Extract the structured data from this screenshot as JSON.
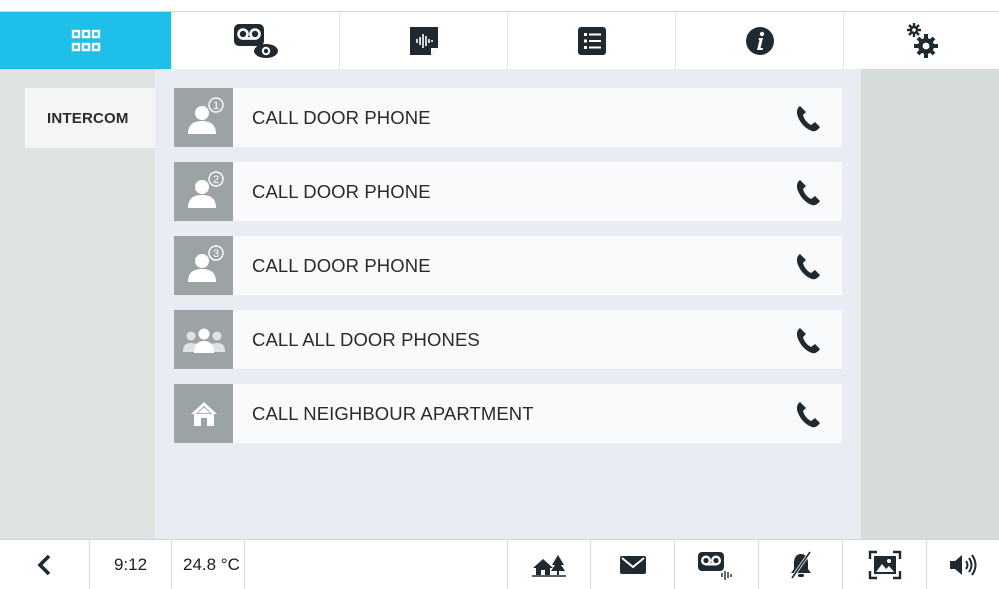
{
  "colors": {
    "accent": "#1ec0ea",
    "icon_dark": "#1f2a30",
    "icon_tile": "#9ba3a5"
  },
  "topnav": {
    "tabs": [
      {
        "name": "home-grid",
        "icon": "grid-icon",
        "active": true
      },
      {
        "name": "video-surveillance",
        "icon": "voicemail-eye-icon",
        "active": false
      },
      {
        "name": "audio-messages",
        "icon": "audio-wave-icon",
        "active": false
      },
      {
        "name": "list",
        "icon": "list-icon",
        "active": false
      },
      {
        "name": "info",
        "icon": "info-icon",
        "active": false
      },
      {
        "name": "settings",
        "icon": "gears-icon",
        "active": false
      }
    ]
  },
  "sidebar": {
    "items": [
      {
        "label": "INTERCOM",
        "selected": true
      }
    ]
  },
  "main": {
    "rows": [
      {
        "label": "CALL DOOR PHONE",
        "icon": "person-icon",
        "badge": "1",
        "action_icon": "phone-icon"
      },
      {
        "label": "CALL DOOR PHONE",
        "icon": "person-icon",
        "badge": "2",
        "action_icon": "phone-icon"
      },
      {
        "label": "CALL DOOR PHONE",
        "icon": "person-icon",
        "badge": "3",
        "action_icon": "phone-icon"
      },
      {
        "label": "CALL ALL DOOR PHONES",
        "icon": "group-icon",
        "badge": "",
        "action_icon": "phone-icon"
      },
      {
        "label": "CALL NEIGHBOUR APARTMENT",
        "icon": "house-icon",
        "badge": "",
        "action_icon": "phone-icon"
      }
    ]
  },
  "status": {
    "time": "9:12",
    "temperature": "24.8 °C",
    "icons": [
      "back-icon",
      "home-tree-icon",
      "mail-icon",
      "voicemail-audio-icon",
      "bell-muted-icon",
      "picture-frame-icon",
      "speaker-icon"
    ]
  }
}
